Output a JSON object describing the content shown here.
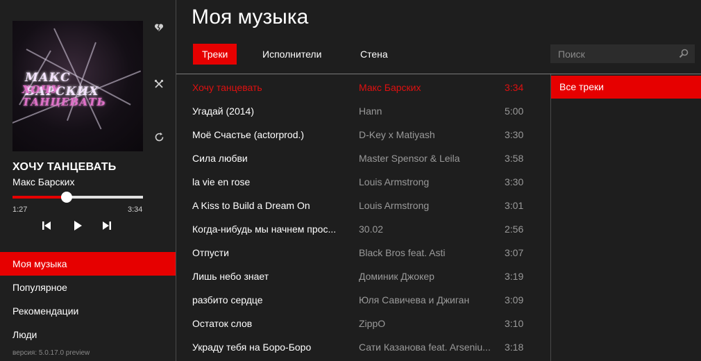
{
  "player": {
    "cover_brand": "МАКС БАРСКИХ",
    "cover_text": "ХОЧУ ТАНЦЕВАТЬ",
    "title": "ХОЧУ ТАНЦЕВАТЬ",
    "artist": "Макс Барских",
    "current_time": "1:27",
    "total_time": "3:34",
    "progress": 0.415,
    "icons": [
      "broken-heart-icon",
      "crossed-tools-icon",
      "repeat-icon",
      "previous-icon",
      "play-icon",
      "next-icon"
    ]
  },
  "nav": {
    "items": [
      {
        "label": "Моя музыка",
        "active": true
      },
      {
        "label": "Популярное",
        "active": false
      },
      {
        "label": "Рекомендации",
        "active": false
      },
      {
        "label": "Люди",
        "active": false
      }
    ],
    "version": "версия: 5.0.17.0 preview"
  },
  "header": {
    "title": "Моя музыка",
    "tabs": [
      {
        "label": "Треки",
        "active": true
      },
      {
        "label": "Исполнители",
        "active": false
      },
      {
        "label": "Стена",
        "active": false
      }
    ]
  },
  "search": {
    "placeholder": "Поиск",
    "value": ""
  },
  "tracks": [
    {
      "title": "Хочу танцевать",
      "artist": "Макс Барских",
      "duration": "3:34",
      "playing": true
    },
    {
      "title": "Угадай (2014)",
      "artist": "Hann",
      "duration": "5:00",
      "playing": false
    },
    {
      "title": "Моё Счастье (actorprod.)",
      "artist": "D-Key x Matiyash",
      "duration": "3:30",
      "playing": false
    },
    {
      "title": "Сила любви",
      "artist": "Master Spensor & Leila",
      "duration": "3:58",
      "playing": false
    },
    {
      "title": "la vie en rose",
      "artist": "Louis Armstrong",
      "duration": "3:30",
      "playing": false
    },
    {
      "title": "A Kiss to Build a Dream On",
      "artist": "Louis Armstrong",
      "duration": "3:01",
      "playing": false
    },
    {
      "title": "Когда-нибудь мы начнем прос...",
      "artist": "30.02",
      "duration": "2:56",
      "playing": false
    },
    {
      "title": "Отпусти",
      "artist": "Black Bros feat. Asti",
      "duration": "3:07",
      "playing": false
    },
    {
      "title": "Лишь небо знает",
      "artist": "Доминик Джокер",
      "duration": "3:19",
      "playing": false
    },
    {
      "title": "разбито сердце",
      "artist": "Юля Савичева и Джиган",
      "duration": "3:09",
      "playing": false
    },
    {
      "title": "Остаток слов",
      "artist": "ZippO",
      "duration": "3:10",
      "playing": false
    },
    {
      "title": "Украду тебя на Боро-Боро",
      "artist": "Сати Казанова feat. Arseniu...",
      "duration": "3:18",
      "playing": false
    }
  ],
  "filters": [
    {
      "label": "Все треки",
      "active": true
    }
  ],
  "colors": {
    "accent": "#e60000",
    "playing_text": "#e01010",
    "background": "#1e1e1e",
    "muted_text": "#9a9a9a"
  }
}
